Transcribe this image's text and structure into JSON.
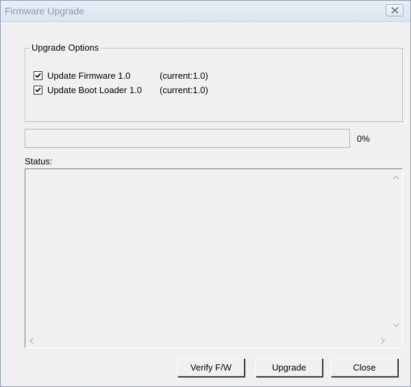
{
  "window": {
    "title": "Firmware Upgrade"
  },
  "options": {
    "group_label": "Upgrade Options",
    "items": [
      {
        "label": "Update Firmware 1.0",
        "current": "(current:1.0)",
        "checked": true
      },
      {
        "label": "Update Boot Loader 1.0",
        "current": "(current:1.0)",
        "checked": true
      }
    ]
  },
  "progress": {
    "value": 0,
    "percent_text": "0%"
  },
  "status": {
    "label": "Status:",
    "text": ""
  },
  "buttons": {
    "verify": "Verify F/W",
    "upgrade": "Upgrade",
    "close": "Close"
  }
}
